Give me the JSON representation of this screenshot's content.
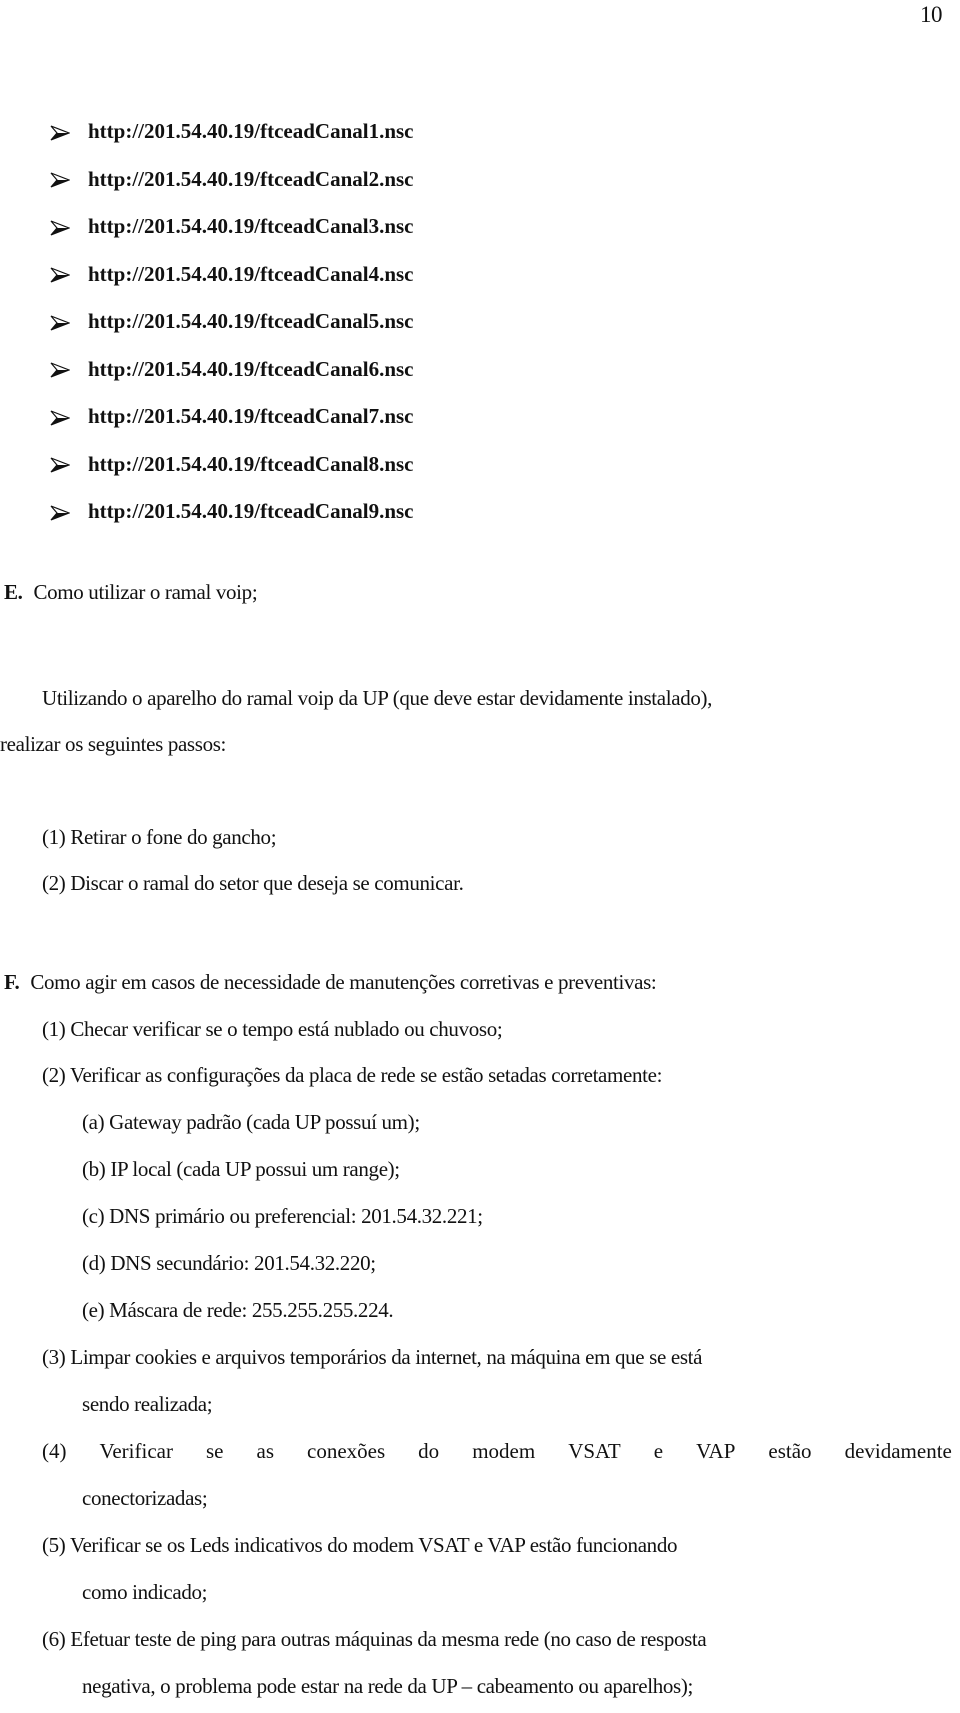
{
  "page_number": "10",
  "links": [
    "http://201.54.40.19/ftceadCanal1.nsc",
    "http://201.54.40.19/ftceadCanal2.nsc",
    "http://201.54.40.19/ftceadCanal3.nsc",
    "http://201.54.40.19/ftceadCanal4.nsc",
    "http://201.54.40.19/ftceadCanal5.nsc",
    "http://201.54.40.19/ftceadCanal6.nsc",
    "http://201.54.40.19/ftceadCanal7.nsc",
    "http://201.54.40.19/ftceadCanal8.nsc",
    "http://201.54.40.19/ftceadCanal9.nsc"
  ],
  "section_e": {
    "letter": "E.",
    "title": "Como utilizar o ramal voip;",
    "paragraph_line1": "Utilizando o aparelho do ramal voip da UP (que deve estar devidamente instalado),",
    "paragraph_line2": "realizar os seguintes passos:",
    "steps": [
      {
        "num": "(1)",
        "text": "Retirar o fone do gancho;"
      },
      {
        "num": "(2)",
        "text": "Discar o ramal do setor que deseja se comunicar."
      }
    ]
  },
  "section_f": {
    "letter": "F.",
    "title": "Como agir em casos de necessidade de manutenções corretivas e preventivas:",
    "step1": {
      "num": "(1)",
      "text": "Checar verificar se o tempo está nublado ou chuvoso;"
    },
    "step2": {
      "num": "(2)",
      "text": "Verificar as configurações da placa de rede se estão setadas corretamente:"
    },
    "sub_items": [
      {
        "num": "(a)",
        "text": "Gateway padrão (cada UP possuí um);"
      },
      {
        "num": "(b)",
        "text": "IP local (cada UP possui um range);"
      },
      {
        "num": "(c)",
        "text": "DNS primário ou preferencial: 201.54.32.221;"
      },
      {
        "num": "(d)",
        "text": "DNS secundário: 201.54.32.220;"
      },
      {
        "num": "(e)",
        "text": "Máscara de rede: 255.255.255.224."
      }
    ],
    "step3": {
      "num": "(3)",
      "line1": "Limpar cookies e arquivos temporários da internet, na máquina em que se está",
      "line2": "sendo realizada;"
    },
    "step4": {
      "num": "(4)",
      "line1_words": [
        "Verificar",
        "se",
        "as",
        "conexões",
        "do",
        "modem",
        "VSAT",
        "e",
        "VAP",
        "estão",
        "devidamente"
      ],
      "line2": "conectorizadas;"
    },
    "step5": {
      "num": "(5)",
      "line1": "Verificar se os Leds indicativos do modem VSAT e VAP estão funcionando",
      "line2": "como indicado;"
    },
    "step6": {
      "num": "(6)",
      "line1": "Efetuar teste de ping para outras máquinas da mesma rede (no caso de resposta",
      "line2": "negativa, o problema pode estar na rede da UP – cabeamento ou aparelhos);"
    }
  }
}
